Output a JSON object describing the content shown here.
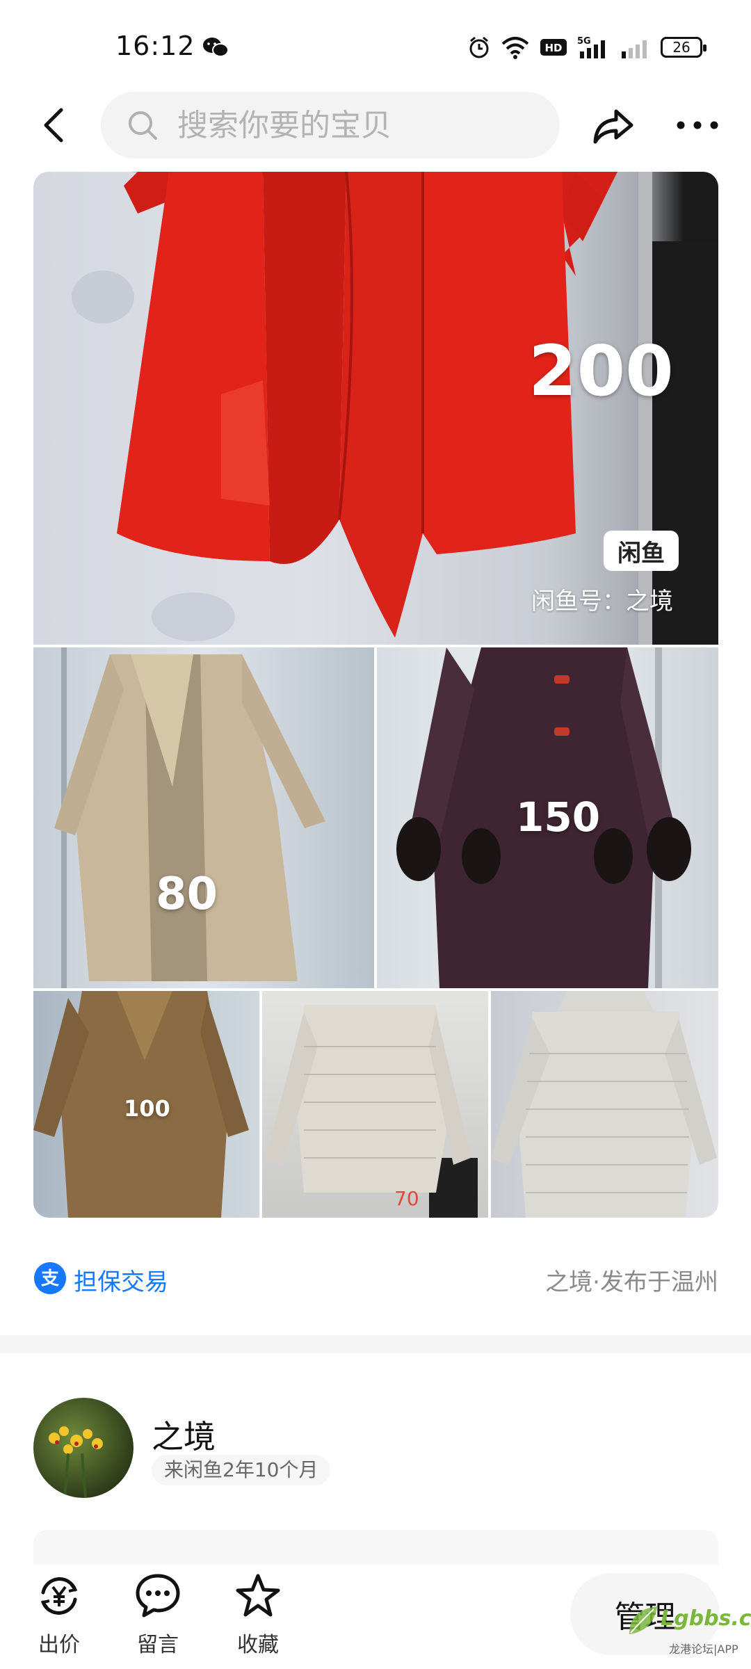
{
  "status_bar": {
    "time": "16:12",
    "battery": "26"
  },
  "nav": {
    "search_placeholder": "搜索你要的宝贝"
  },
  "collage": {
    "labels": [
      "200",
      "80",
      "150",
      "100",
      "70"
    ],
    "badge": "闲鱼",
    "id_text": "闲鱼号：之境"
  },
  "trade": {
    "label": "担保交易",
    "location": "之境·发布于温州"
  },
  "seller": {
    "name": "之境",
    "tenure": "来闲鱼2年10个月"
  },
  "bottom_bar": {
    "offer_label": "出价",
    "comment_label": "留言",
    "favorite_label": "收藏",
    "manage_label": "管理"
  },
  "watermark": {
    "text": "Lgbbs.cn",
    "sub": "龙港论坛|APP"
  },
  "colors": {
    "link_blue": "#1677ff",
    "coat_red": "#e2231a",
    "watermark_green": "#7ab83c"
  }
}
